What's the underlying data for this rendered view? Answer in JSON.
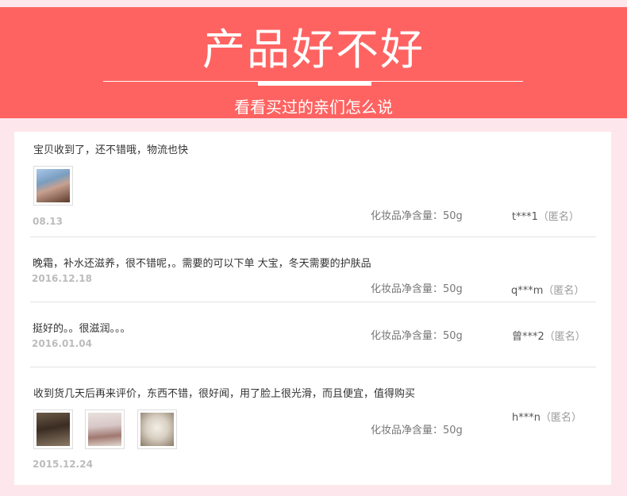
{
  "banner": {
    "title": "产品好不好",
    "subtitle": "看看买过的亲们怎么说"
  },
  "reviews": [
    {
      "text": "宝贝收到了，还不错哦，物流也快",
      "date": "08.13",
      "spec": "化妆品净含量：50g",
      "user": "t***1",
      "anon": "（匿名）",
      "photos": [
        "product-photo-1"
      ]
    },
    {
      "text": "晚霜，补水还滋养，很不错呢，。需要的可以下单 大宝，冬天需要的护肤品",
      "date": "2016.12.18",
      "spec": "化妆品净含量：50g",
      "user": "q***m",
      "anon": "（匿名）",
      "photos": []
    },
    {
      "text": "挺好的。。很滋润。。。",
      "date": "2016.01.04",
      "spec": "化妆品净含量：50g",
      "user": "曾***2",
      "anon": "（匿名）",
      "photos": []
    },
    {
      "text": "收到货几天后再来评价，东西不错，很好闻，用了脸上很光滑，而且便宜，值得购买",
      "date": "2015.12.24",
      "spec": "化妆品净含量：50g",
      "user": "h***n",
      "anon": "（匿名）",
      "photos": [
        "product-photo-2",
        "product-photo-3",
        "product-photo-4"
      ]
    }
  ],
  "colors": {
    "banner": "#fe6361",
    "page_background": "#fde6ec"
  }
}
